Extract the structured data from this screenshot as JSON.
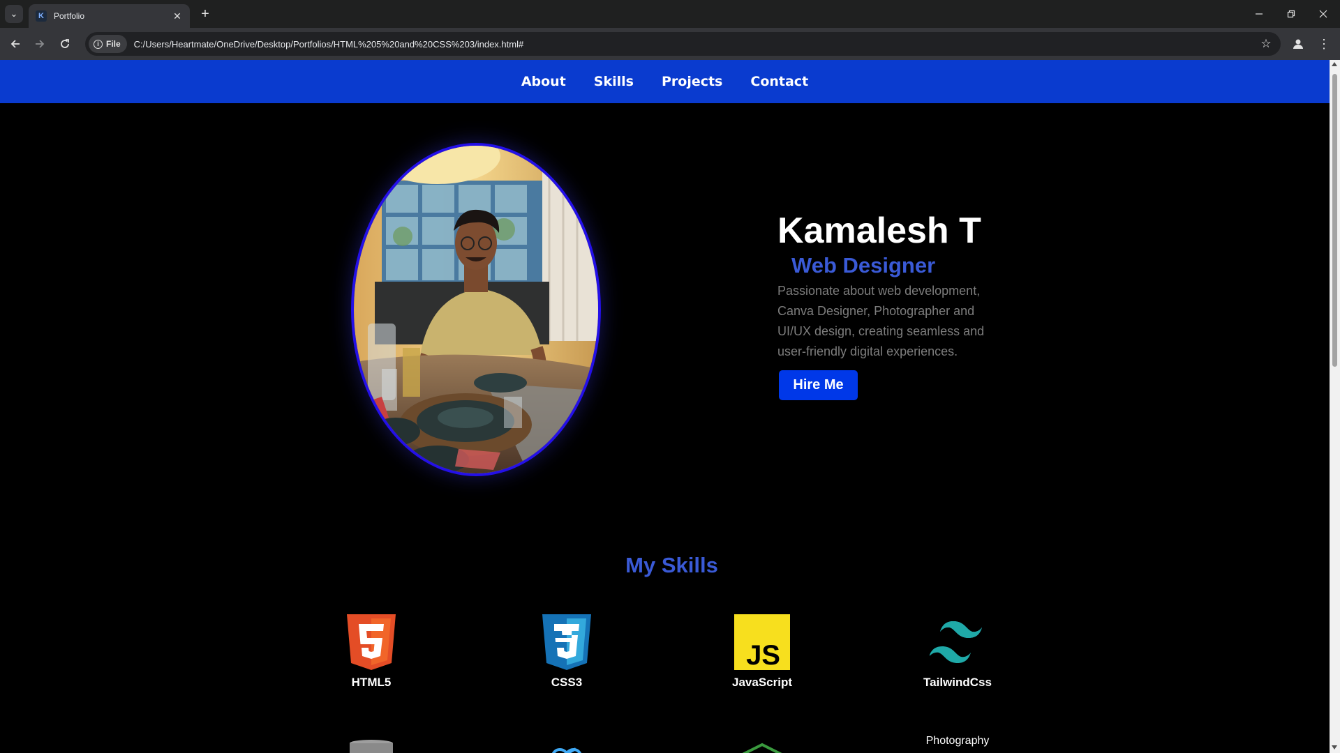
{
  "browser": {
    "tab_title": "Portfolio",
    "tab_favicon": "K",
    "site_chip": "File",
    "url": "C:/Users/Heartmate/OneDrive/Desktop/Portfolios/HTML%205%20and%20CSS%203/index.html#"
  },
  "nav": {
    "items": [
      "About",
      "Skills",
      "Projects",
      "Contact"
    ]
  },
  "hero": {
    "name": "Kamalesh T",
    "role": "Web Designer",
    "description": "Passionate about web development, Canva Designer, Photographer and UI/UX design, creating seamless and user-friendly digital experiences.",
    "cta": "Hire Me"
  },
  "skills": {
    "title": "My Skills",
    "items": [
      {
        "label": "HTML5",
        "icon": "html5-icon"
      },
      {
        "label": "CSS3",
        "icon": "css3-icon"
      },
      {
        "label": "JavaScript",
        "icon": "javascript-icon"
      },
      {
        "label": "TailwindCss",
        "icon": "tailwind-icon"
      }
    ],
    "second_row": [
      {
        "icon": "database-icon"
      },
      {
        "icon": "infinity-icon"
      },
      {
        "icon": "house-icon"
      },
      {
        "broken_image_alt": "Photography"
      }
    ]
  },
  "colors": {
    "nav_bg": "#0a3bcf",
    "accent": "#3a5ad6",
    "button": "#0038e8",
    "avatar_border": "#2410e8"
  }
}
